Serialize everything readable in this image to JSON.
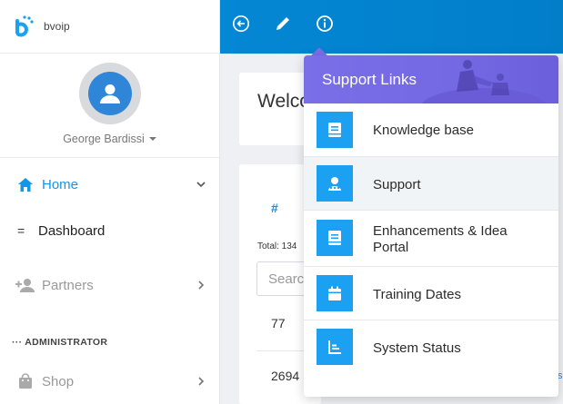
{
  "brand": {
    "name": "bvoip",
    "color": "#1ba0f2"
  },
  "user": {
    "name": "George Bardissi"
  },
  "sidebar": {
    "home_label": "Home",
    "dashboard_label": "Dashboard",
    "dashboard_bullet": "=",
    "partners_label": "Partners",
    "admin_section": "ADMINISTRATOR",
    "admin_dots": "···",
    "shop_label": "Shop"
  },
  "main": {
    "welcome_text": "Welco",
    "table_hash": "#",
    "total_text": "Total: 134",
    "search_placeholder": "Searc",
    "rows": [
      "77",
      "2694"
    ],
    "edge_text": "s"
  },
  "support_links": {
    "title": "Support Links",
    "items": [
      {
        "label": "Knowledge base",
        "icon": "book-icon"
      },
      {
        "label": "Support",
        "icon": "agent-icon"
      },
      {
        "label": "Enhancements & Idea Portal",
        "icon": "book-icon"
      },
      {
        "label": "Training Dates",
        "icon": "calendar-icon"
      },
      {
        "label": "System Status",
        "icon": "chart-icon"
      }
    ]
  },
  "colors": {
    "accent": "#1595e8",
    "topbar": "#0487d4",
    "dropdown_header": "#7b6fe8",
    "icon_tile": "#1ba0f2"
  }
}
